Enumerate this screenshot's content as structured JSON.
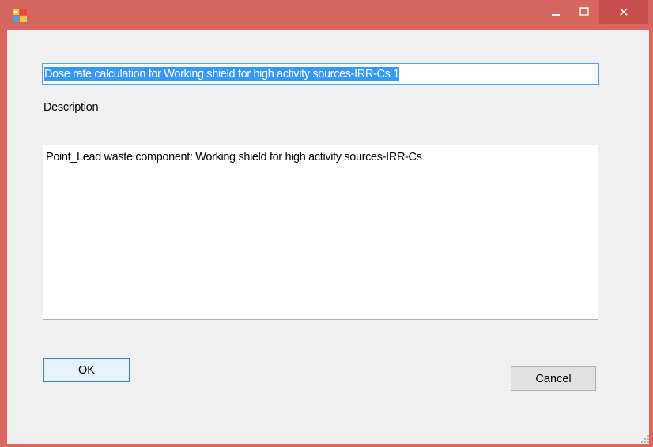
{
  "window": {
    "title": "",
    "controls": {
      "minimize_icon": "minimize-icon",
      "maximize_icon": "maximize-icon",
      "close_glyph": "✕"
    },
    "colors": {
      "titlebar": "#d7665e",
      "close_button": "#c7504a",
      "client_background": "#f0f0f0",
      "selection": "#3399ff",
      "focus_border": "#569de5"
    }
  },
  "form": {
    "name_value": "Dose rate calculation for Working shield for high activity sources-IRR-Cs 1",
    "description_label": "Description",
    "description_value": "Point_Lead waste component: Working shield for high activity sources-IRR-Cs",
    "ok_label": "OK",
    "cancel_label": "Cancel"
  }
}
